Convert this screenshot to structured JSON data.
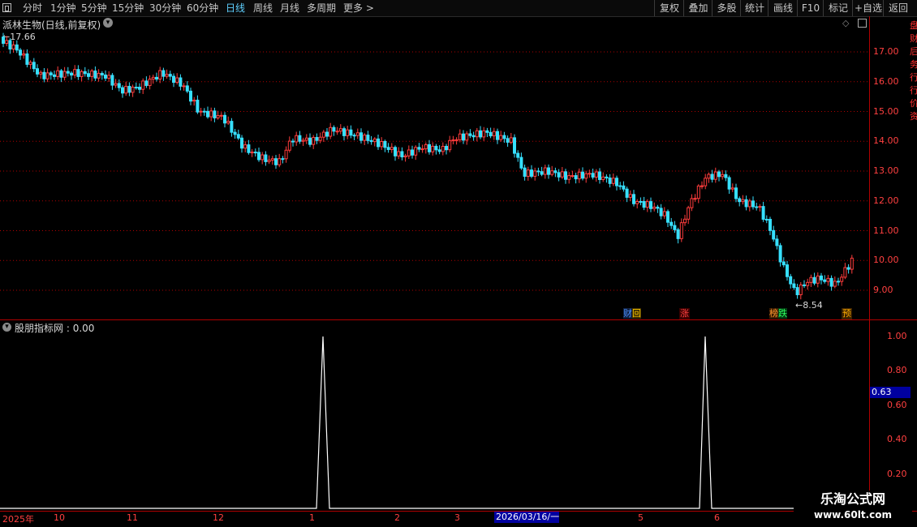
{
  "toolbar": {
    "periods": [
      "分时",
      "1分钟",
      "5分钟",
      "15分钟",
      "30分钟",
      "60分钟",
      "日线",
      "周线",
      "月线",
      "多周期",
      "更多 >"
    ],
    "active_period": "日线",
    "right_buttons": [
      "复权",
      "叠加",
      "多股",
      "统计",
      "画线",
      "F10",
      "标记",
      "+自选",
      "返回"
    ]
  },
  "main_chart": {
    "title": "派林生物(日线,前复权)",
    "high_label": "17.66",
    "low_label": "8.54",
    "y_ticks": [
      "17.00",
      "16.00",
      "15.00",
      "14.00",
      "13.00",
      "12.00",
      "11.00",
      "10.00",
      "9.00"
    ],
    "markers": [
      {
        "text": "财",
        "color": "#4a90ff",
        "bg": "#1a1a40"
      },
      {
        "text": "回",
        "color": "#ffcc00",
        "bg": "#3a2a00"
      },
      {
        "text": "涨",
        "color": "#ff4040",
        "bg": "#3a0000"
      },
      {
        "text": "榜",
        "color": "#ff9a30",
        "bg": "#3a1a00"
      },
      {
        "text": "跌",
        "color": "#30ff60",
        "bg": "#003a10"
      },
      {
        "text": "预",
        "color": "#ffae00",
        "bg": "#3a2000"
      }
    ],
    "colors": {
      "up": "#ff3c3c",
      "down": "#36e0ff",
      "grid": "#b00000"
    }
  },
  "indicator": {
    "title": "股朋指标网",
    "value": "0.00",
    "y_ticks": [
      "1.00",
      "0.80",
      "0.60",
      "0.40",
      "0.20"
    ],
    "current_value": "0.63"
  },
  "time_axis": {
    "labels": [
      "2025年",
      "10",
      "11",
      "12",
      "1",
      "2",
      "3",
      "5",
      "6"
    ],
    "highlight": "2026/03/16/一"
  },
  "watermark": {
    "line1": "乐淘公式网",
    "line2": "www.60lt.com"
  },
  "right_strip_text": "盘 财 后 务 行 行 价 资"
}
